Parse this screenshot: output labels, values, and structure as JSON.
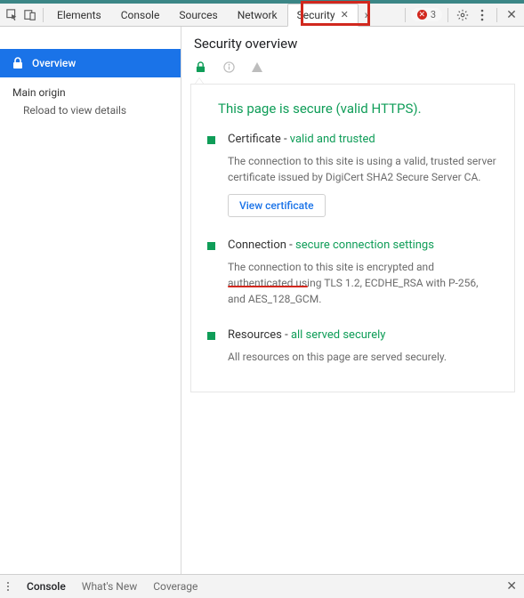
{
  "tabs": {
    "elements": "Elements",
    "console": "Console",
    "sources": "Sources",
    "network": "Network",
    "security": "Security"
  },
  "error_count": "3",
  "sidebar": {
    "overview": "Overview",
    "main_origin": "Main origin",
    "reload": "Reload to view details"
  },
  "panel": {
    "title": "Security overview",
    "status": "This page is secure (valid HTTPS).",
    "cert": {
      "title": "Certificate",
      "status": "valid and trusted",
      "desc": "The connection to this site is using a valid, trusted server certificate issued by DigiCert SHA2 Secure Server CA.",
      "button": "View certificate"
    },
    "conn": {
      "title": "Connection",
      "status": "secure connection settings",
      "desc": "The connection to this site is encrypted and authenticated using TLS 1.2, ECDHE_RSA with P-256, and AES_128_GCM."
    },
    "res": {
      "title": "Resources",
      "status": "all served securely",
      "desc": "All resources on this page are served securely."
    }
  },
  "drawer": {
    "console": "Console",
    "whatsnew": "What's New",
    "coverage": "Coverage"
  }
}
